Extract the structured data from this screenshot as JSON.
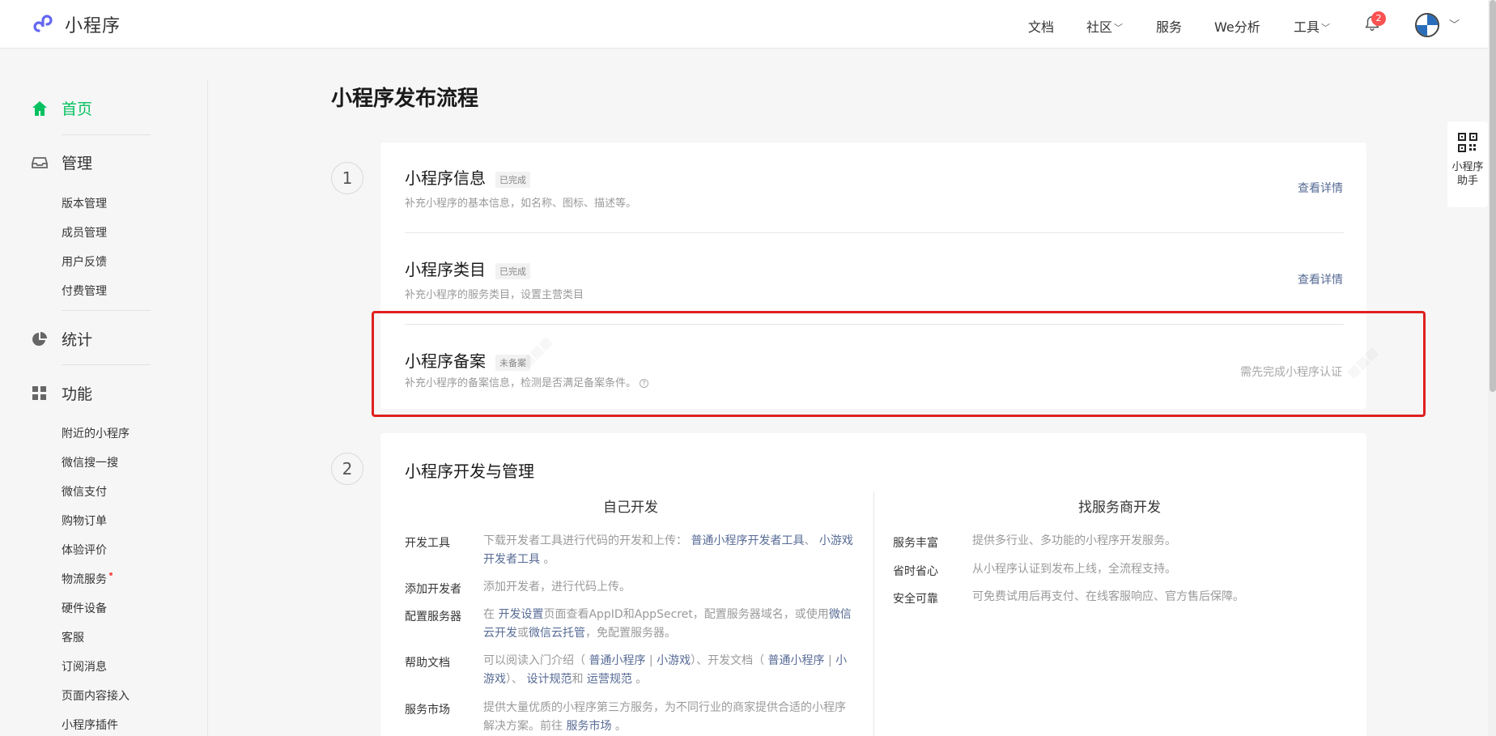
{
  "header": {
    "brand": "小程序",
    "nav": [
      {
        "label": "文档",
        "dropdown": false
      },
      {
        "label": "社区",
        "dropdown": true
      },
      {
        "label": "服务",
        "dropdown": false
      },
      {
        "label": "We分析",
        "dropdown": false
      },
      {
        "label": "工具",
        "dropdown": true
      }
    ],
    "notification_count": "2",
    "icons": [
      "bell-icon",
      "avatar",
      "chevron-down-icon"
    ]
  },
  "sidebar": {
    "home": "首页",
    "manage": {
      "label": "管理",
      "items": [
        "版本管理",
        "成员管理",
        "用户反馈",
        "付费管理"
      ]
    },
    "stats": "统计",
    "features": {
      "label": "功能",
      "items": [
        "附近的小程序",
        "微信搜一搜",
        "微信支付",
        "购物订单",
        "体验评价",
        "物流服务",
        "硬件设备",
        "客服",
        "订阅消息",
        "页面内容接入",
        "小程序插件"
      ]
    }
  },
  "main": {
    "title": "小程序发布流程",
    "step1": {
      "num": "1",
      "rows": [
        {
          "title": "小程序信息",
          "tag": "已完成",
          "desc": "补充小程序的基本信息，如名称、图标、描述等。",
          "action": "查看详情"
        },
        {
          "title": "小程序类目",
          "tag": "已完成",
          "desc": "补充小程序的服务类目，设置主营类目",
          "action": "查看详情"
        },
        {
          "title": "小程序备案",
          "tag": "未备案",
          "desc": "补充小程序的备案信息，检测是否满足备案条件。",
          "note": "需先完成小程序认证"
        }
      ]
    },
    "step2": {
      "num": "2",
      "title": "小程序开发与管理",
      "self_dev": {
        "heading": "自己开发",
        "items": [
          {
            "label": "开发工具",
            "text": "下载开发者工具进行代码的开发和上传：",
            "link1": "普通小程序开发者工具",
            "sep": "、",
            "link2": "小游戏开发者工具",
            "end": "。"
          },
          {
            "label": "添加开发者",
            "text": "添加开发者，进行代码上传。"
          },
          {
            "label": "配置服务器",
            "pre": "在",
            "link1": "开发设置",
            "mid": "页面查看AppID和AppSecret，配置服务器域名，或使用",
            "link2": "微信云开发",
            "or": "或",
            "link3": "微信云托管",
            "end": "，免配置服务器。"
          },
          {
            "label": "帮助文档",
            "pre": "可以阅读入门介绍（",
            "link1": "普通小程序",
            "bar": "|",
            "link2": "小游戏",
            "mid": "）、开发文档（",
            "link3": "普通小程序",
            "link4": "小游戏",
            "mid2": "）、",
            "link5": "设计规范",
            "and": "和",
            "link6": "运营规范",
            "end": "。"
          },
          {
            "label": "服务市场",
            "pre": "提供大量优质的小程序第三方服务，为不同行业的商家提供合适的小程序解决方案。前往",
            "link1": "服务市场",
            "end": "。"
          }
        ]
      },
      "provider_dev": {
        "heading": "找服务商开发",
        "items": [
          {
            "label": "服务丰富",
            "text": "提供多行业、多功能的小程序开发服务。"
          },
          {
            "label": "省时省心",
            "text": "从小程序认证到发布上线，全流程支持。"
          },
          {
            "label": "安全可靠",
            "text": "可免费试用后再支付、在线客服响应、官方售后保障。"
          }
        ]
      }
    }
  },
  "helper": {
    "label_line1": "小程序",
    "label_line2": "助手"
  },
  "colors": {
    "accent": "#07c160",
    "link": "#576b95",
    "highlight": "#e02020",
    "badge": "#fa5151"
  }
}
